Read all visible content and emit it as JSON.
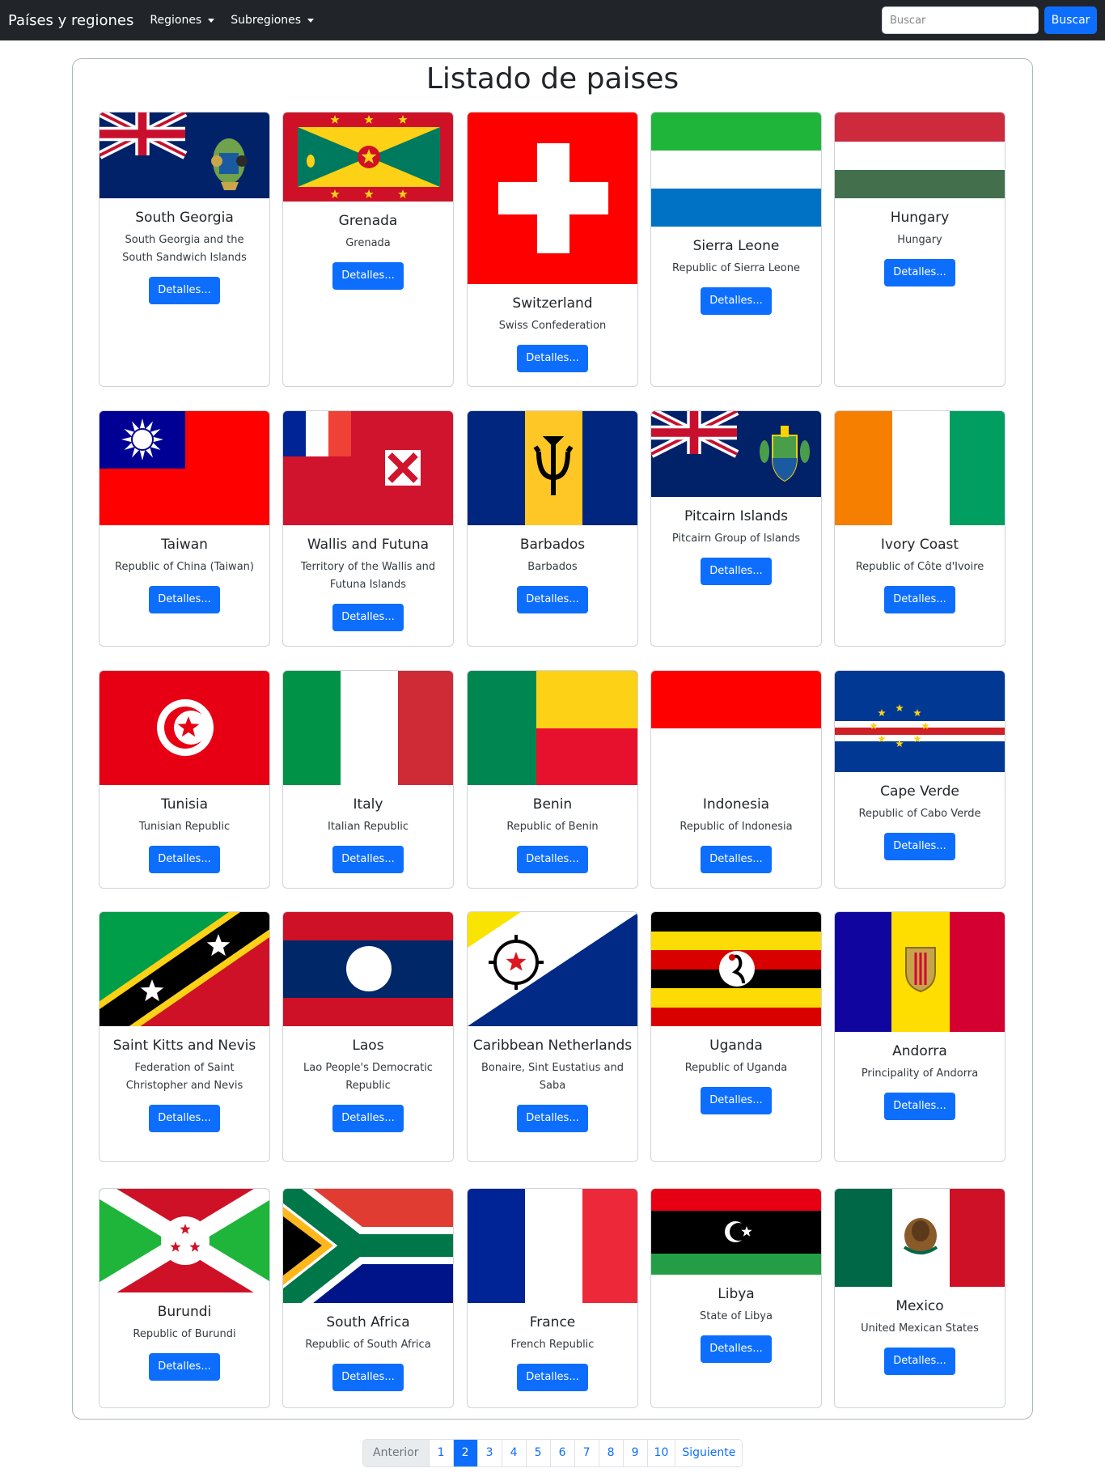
{
  "navbar": {
    "brand": "Países y regiones",
    "menu": [
      {
        "label": "Regiones"
      },
      {
        "label": "Subregiones"
      }
    ],
    "search_placeholder": "Buscar",
    "search_button": "Buscar"
  },
  "page_title": "Listado de paises",
  "button_label": "Detalles...",
  "countries": [
    {
      "name": "South Georgia",
      "official": "South Georgia and the South Sandwich Islands",
      "flag": "south-georgia-flag"
    },
    {
      "name": "Grenada",
      "official": "Grenada",
      "flag": "grenada-flag"
    },
    {
      "name": "Switzerland",
      "official": "Swiss Confederation",
      "flag": "switzerland-flag"
    },
    {
      "name": "Sierra Leone",
      "official": "Republic of Sierra Leone",
      "flag": "sierra-leone-flag"
    },
    {
      "name": "Hungary",
      "official": "Hungary",
      "flag": "hungary-flag"
    },
    {
      "name": "Taiwan",
      "official": "Republic of China (Taiwan)",
      "flag": "taiwan-flag"
    },
    {
      "name": "Wallis and Futuna",
      "official": "Territory of the Wallis and Futuna Islands",
      "flag": "wallis-futuna-flag"
    },
    {
      "name": "Barbados",
      "official": "Barbados",
      "flag": "barbados-flag"
    },
    {
      "name": "Pitcairn Islands",
      "official": "Pitcairn Group of Islands",
      "flag": "pitcairn-flag"
    },
    {
      "name": "Ivory Coast",
      "official": "Republic of Côte d'Ivoire",
      "flag": "ivory-coast-flag"
    },
    {
      "name": "Tunisia",
      "official": "Tunisian Republic",
      "flag": "tunisia-flag"
    },
    {
      "name": "Italy",
      "official": "Italian Republic",
      "flag": "italy-flag"
    },
    {
      "name": "Benin",
      "official": "Republic of Benin",
      "flag": "benin-flag"
    },
    {
      "name": "Indonesia",
      "official": "Republic of Indonesia",
      "flag": "indonesia-flag"
    },
    {
      "name": "Cape Verde",
      "official": "Republic of Cabo Verde",
      "flag": "cape-verde-flag"
    },
    {
      "name": "Saint Kitts and Nevis",
      "official": "Federation of Saint Christopher and Nevis",
      "flag": "saint-kitts-flag"
    },
    {
      "name": "Laos",
      "official": "Lao People's Democratic Republic",
      "flag": "laos-flag"
    },
    {
      "name": "Caribbean Netherlands",
      "official": "Bonaire, Sint Eustatius and Saba",
      "flag": "caribbean-netherlands-flag"
    },
    {
      "name": "Uganda",
      "official": "Republic of Uganda",
      "flag": "uganda-flag"
    },
    {
      "name": "Andorra",
      "official": "Principality of Andorra",
      "flag": "andorra-flag"
    },
    {
      "name": "Burundi",
      "official": "Republic of Burundi",
      "flag": "burundi-flag"
    },
    {
      "name": "South Africa",
      "official": "Republic of South Africa",
      "flag": "south-africa-flag"
    },
    {
      "name": "France",
      "official": "French Republic",
      "flag": "france-flag"
    },
    {
      "name": "Libya",
      "official": "State of Libya",
      "flag": "libya-flag"
    },
    {
      "name": "Mexico",
      "official": "United Mexican States",
      "flag": "mexico-flag"
    }
  ],
  "pagination": {
    "previous": "Anterior",
    "next": "Siguiente",
    "pages": [
      "1",
      "2",
      "3",
      "4",
      "5",
      "6",
      "7",
      "8",
      "9",
      "10"
    ],
    "active_page": "2"
  },
  "colors": {
    "primary": "#0d6efd",
    "navbar": "#212529"
  }
}
